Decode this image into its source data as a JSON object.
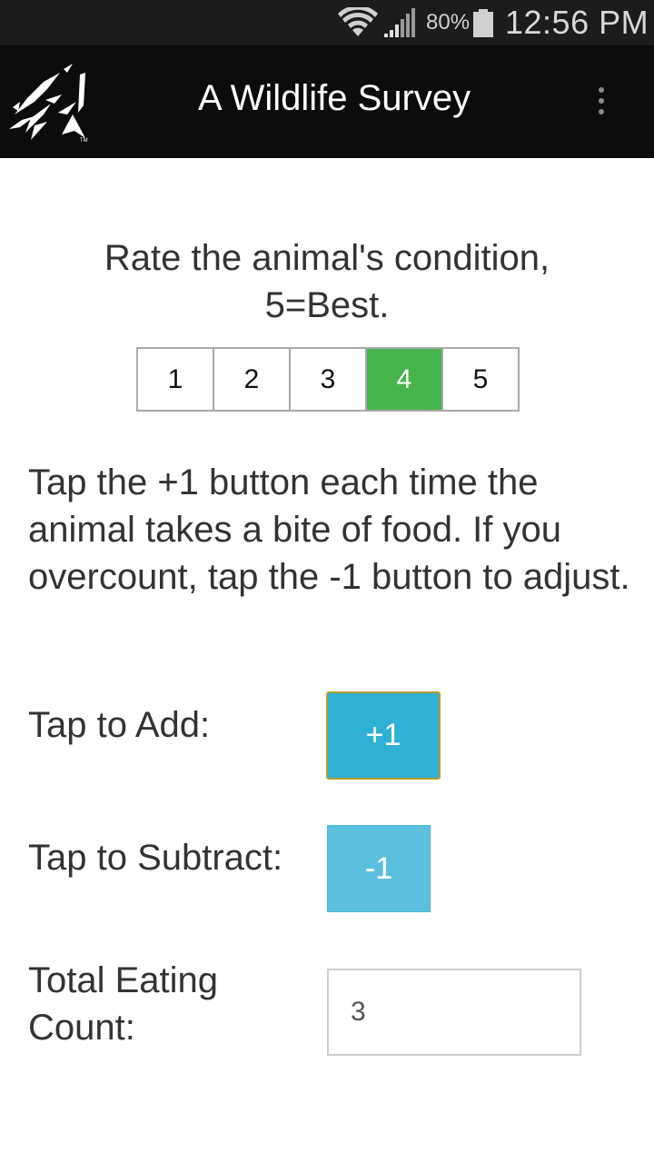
{
  "status_bar": {
    "wifi_icon": "wifi-icon",
    "signal_icon": "cell-signal-icon",
    "battery_percent": "80%",
    "battery_icon": "battery-icon",
    "time": "12:56 PM"
  },
  "app_bar": {
    "logo_icon": "dragon-logo-icon",
    "title": "A Wildlife Survey",
    "menu_icon": "overflow-menu-icon"
  },
  "rating": {
    "label": "Rate the animal's condition, 5=Best.",
    "options": [
      "1",
      "2",
      "3",
      "4",
      "5"
    ],
    "selected": "4",
    "selected_color": "#47b44b"
  },
  "instructions": "Tap the +1 button each time the animal takes a bite of food. If you overcount, tap the -1 button to adjust.",
  "counter": {
    "add_label": "Tap to Add:",
    "add_button": "+1",
    "add_color": "#31b0d5",
    "subtract_label": "Tap to Subtract:",
    "subtract_button": "-1",
    "subtract_color": "#5bc0de",
    "total_label": "Total Eating Count:",
    "total_value": "3"
  }
}
